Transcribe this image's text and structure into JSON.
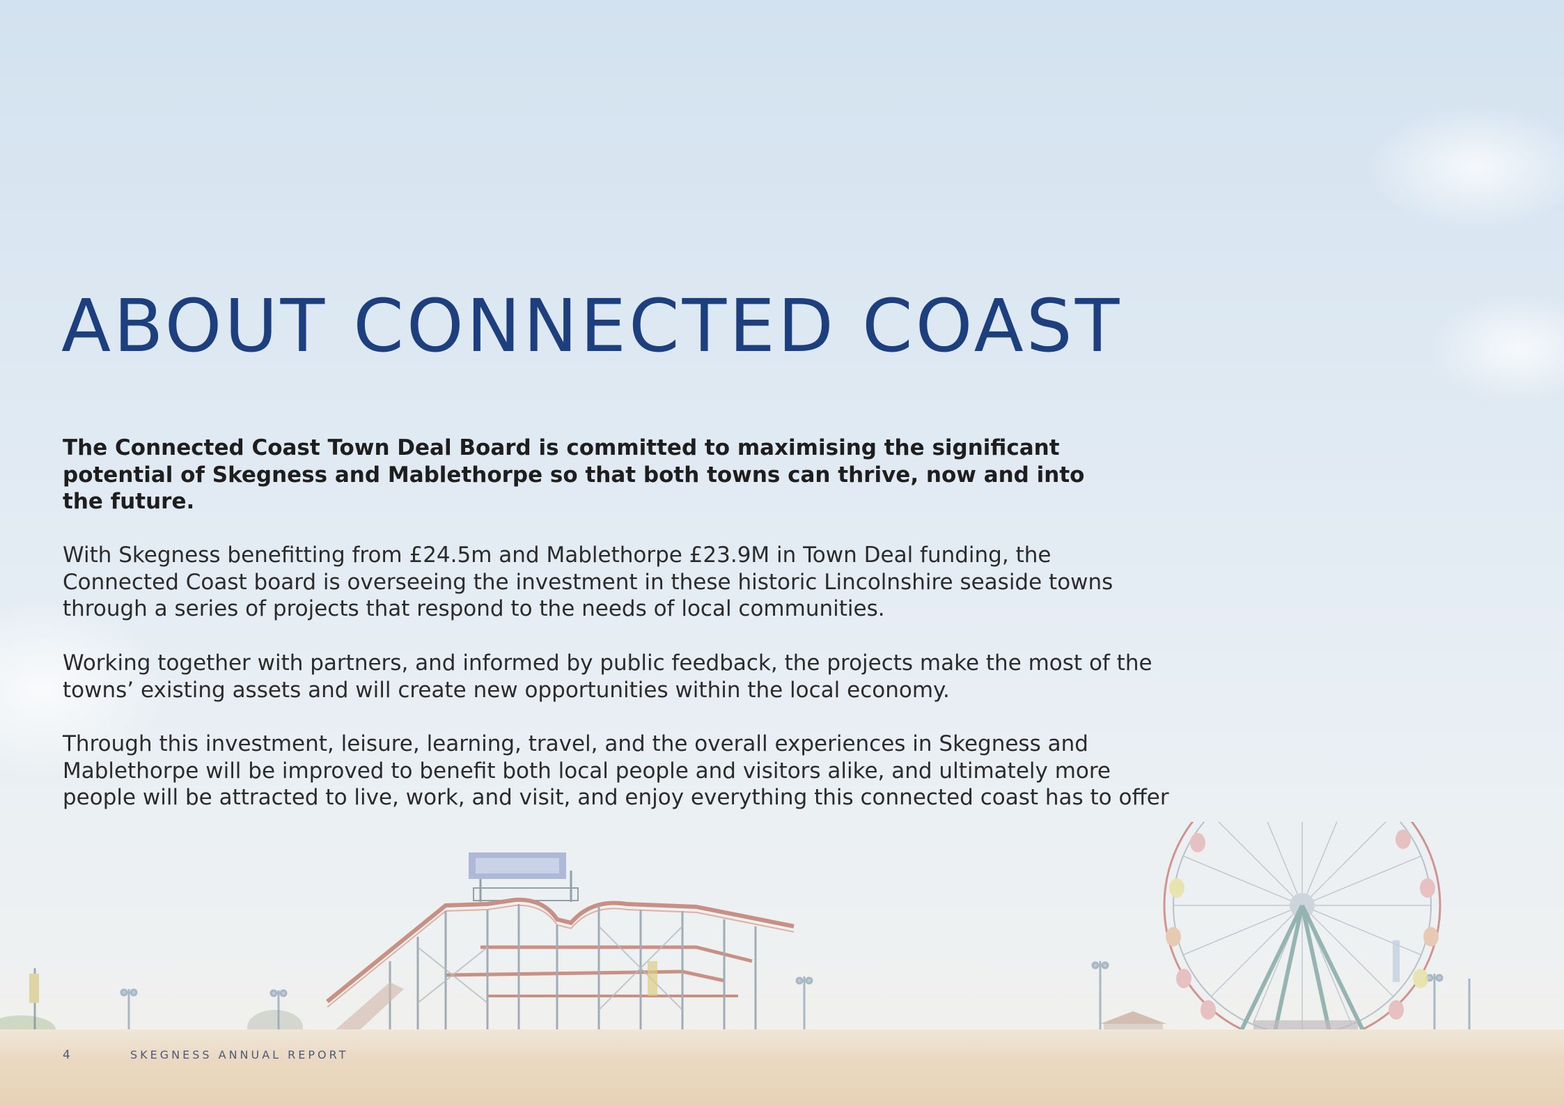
{
  "title": "ABOUT CONNECTED COAST",
  "intro": {
    "lines": [
      "The Connected Coast Town Deal Board is committed to maximising the significant",
      "potential of Skegness and Mablethorpe so that both towns can thrive, now and into",
      "the future."
    ]
  },
  "paragraphs": [
    {
      "lines": [
        "With Skegness benefitting from £24.5m and Mablethorpe £23.9M in Town Deal funding, the",
        "Connected Coast board is overseeing the investment in these historic Lincolnshire seaside towns",
        "through a series of projects that respond to the needs of local communities."
      ]
    },
    {
      "lines": [
        "Working together with partners, and informed by public feedback, the projects make the most of the",
        "towns’ existing assets and will create new opportunities within the local economy."
      ]
    },
    {
      "lines": [
        "Through this investment, leisure, learning, travel, and the overall experiences in Skegness and",
        "Mablethorpe will be improved to benefit both local people and visitors alike, and ultimately more",
        "people will be attracted to live, work, and visit, and enjoy everything this connected coast has to offer"
      ]
    }
  ],
  "footer": {
    "page_number": "4",
    "report_title": "SKEGNESS ANNUAL REPORT"
  },
  "colors": {
    "title": "#1d3f7d",
    "body_text": "#2b2b2b",
    "footer_text": "#4a5a7a"
  }
}
